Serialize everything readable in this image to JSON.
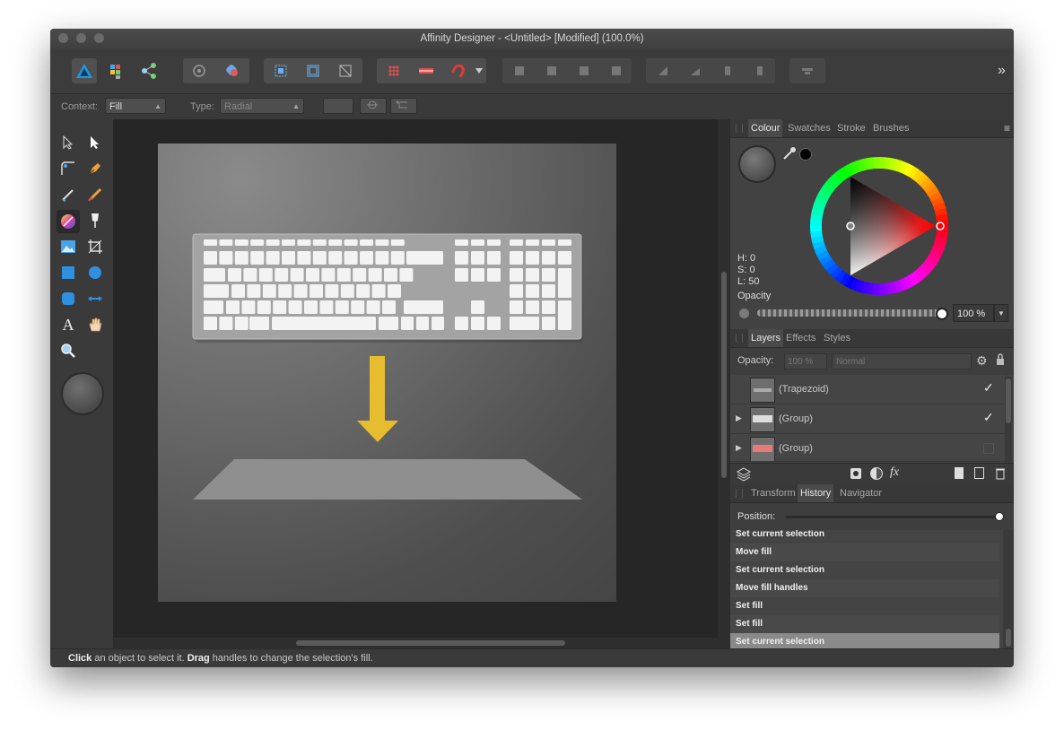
{
  "window": {
    "title": "Affinity Designer - <Untitled> [Modified] (100.0%)"
  },
  "toolbar": {
    "overflow_label": "»"
  },
  "context": {
    "context_label": "Context:",
    "context_value": "Fill",
    "type_label": "Type:",
    "type_value": "Radial"
  },
  "colour_panel": {
    "tabs": [
      "Colour",
      "Swatches",
      "Stroke",
      "Brushes"
    ],
    "active_tab": "Colour",
    "h": "H: 0",
    "s": "S: 0",
    "l": "L: 50",
    "opacity_label": "Opacity",
    "opacity_value": "100 %"
  },
  "layers_panel": {
    "tabs": [
      "Layers",
      "Effects",
      "Styles"
    ],
    "active_tab": "Layers",
    "opacity_label": "Opacity:",
    "opacity_value": "100 %",
    "blend_mode": "Normal",
    "layers": [
      {
        "name": "(Trapezoid)",
        "visible": true
      },
      {
        "name": "(Group)",
        "visible": true
      },
      {
        "name": "(Group)",
        "visible": false
      }
    ],
    "fx_label": "fx"
  },
  "history_panel": {
    "tabs": [
      "Transform",
      "History",
      "Navigator"
    ],
    "active_tab": "History",
    "position_label": "Position:",
    "items": [
      "Set current selection",
      "Move fill",
      "Set current selection",
      "Move fill handles",
      "Set fill",
      "Set fill",
      "Set current selection"
    ]
  },
  "status": {
    "click": "Click",
    "click_text": " an object to select it. ",
    "drag": "Drag",
    "drag_text": " handles to change the selection's fill."
  },
  "colors": {
    "accent_blue": "#1a9ae0",
    "arrow_yellow": "#e6bd2f",
    "selection_grey": "#8f8f8f"
  }
}
